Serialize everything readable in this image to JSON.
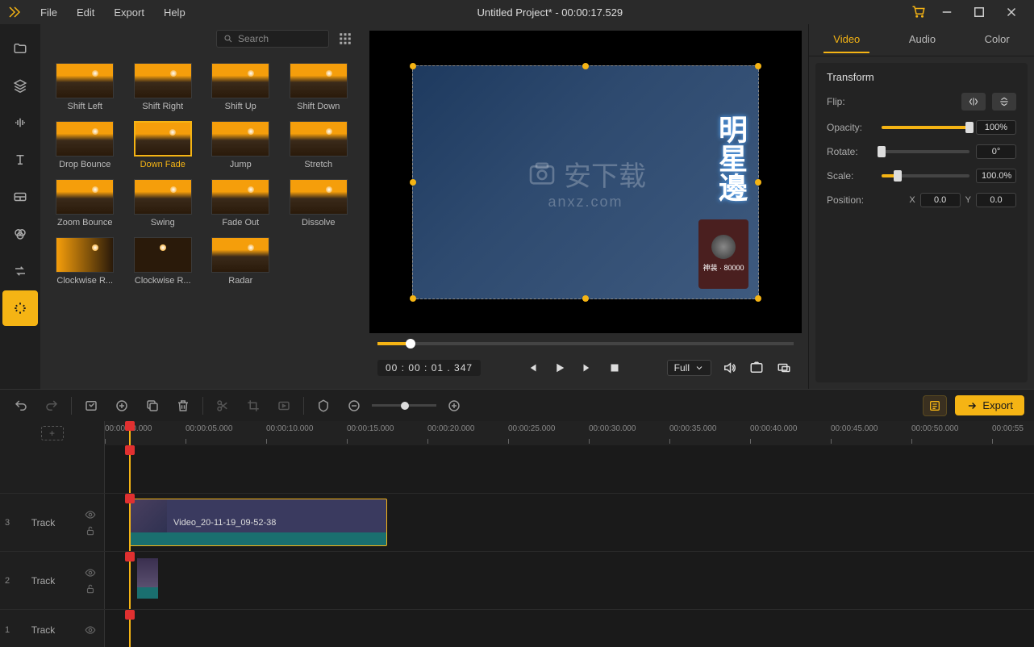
{
  "menus": {
    "file": "File",
    "edit": "Edit",
    "export": "Export",
    "help": "Help"
  },
  "title": "Untitled Project* - 00:00:17.529",
  "search": {
    "placeholder": "Search"
  },
  "effects": [
    {
      "label": "Shift Left"
    },
    {
      "label": "Shift Right"
    },
    {
      "label": "Shift Up"
    },
    {
      "label": "Shift Down"
    },
    {
      "label": "Drop Bounce"
    },
    {
      "label": "Down Fade",
      "selected": true
    },
    {
      "label": "Jump"
    },
    {
      "label": "Stretch"
    },
    {
      "label": "Zoom Bounce"
    },
    {
      "label": "Swing"
    },
    {
      "label": "Fade Out"
    },
    {
      "label": "Dissolve"
    },
    {
      "label": "Clockwise R...",
      "alt": 1
    },
    {
      "label": "Clockwise R...",
      "alt": 2
    },
    {
      "label": "Radar"
    }
  ],
  "preview": {
    "watermark_main": "安下载",
    "watermark_sub": "anxz.com",
    "overlay_text": "明星邊",
    "card_text": "神装 · 80000",
    "time": "00 : 00 : 01 . 347",
    "fit": "Full"
  },
  "props": {
    "tabs": {
      "video": "Video",
      "audio": "Audio",
      "color": "Color"
    },
    "section": "Transform",
    "labels": {
      "flip": "Flip:",
      "opacity": "Opacity:",
      "rotate": "Rotate:",
      "scale": "Scale:",
      "position": "Position:"
    },
    "values": {
      "opacity": "100%",
      "rotate": "0°",
      "scale": "100.0%",
      "posX": "0.0",
      "posY": "0.0",
      "xLabel": "X",
      "yLabel": "Y"
    }
  },
  "export_label": "Export",
  "timeline": {
    "ticks": [
      "00:00:00.000",
      "00:00:05.000",
      "00:00:10.000",
      "00:00:15.000",
      "00:00:20.000",
      "00:00:25.000",
      "00:00:30.000",
      "00:00:35.000",
      "00:00:40.000",
      "00:00:45.000",
      "00:00:50.000",
      "00:00:55"
    ],
    "tracks": [
      {
        "num": "3",
        "label": "Track"
      },
      {
        "num": "2",
        "label": "Track"
      },
      {
        "num": "1",
        "label": "Track"
      }
    ],
    "clip_label": "Video_20-11-19_09-52-38"
  }
}
